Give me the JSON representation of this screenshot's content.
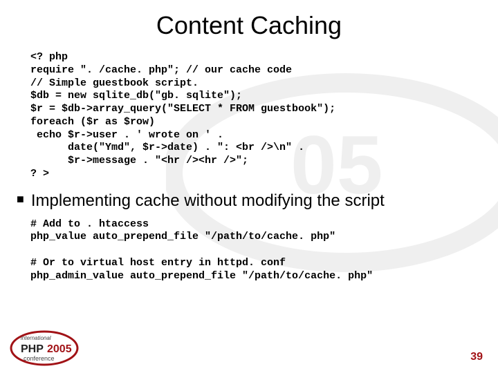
{
  "title": "Content Caching",
  "code_block_1": "<? php\nrequire \". /cache. php\"; // our cache code\n// Simple guestbook script.\n$db = new sqlite_db(\"gb. sqlite\");\n$r = $db->array_query(\"SELECT * FROM guestbook\");\nforeach ($r as $row)\n echo $r->user . ' wrote on ' .\n      date(\"Ymd\", $r->date) . \": <br />\\n\" .\n      $r->message . \"<hr /><hr />\";\n? >",
  "bullet_text": "Implementing cache without modifying the script",
  "code_block_2": "# Add to . htaccess\nphp_value auto_prepend_file \"/path/to/cache. php\"\n\n# Or to virtual host entry in httpd. conf\nphp_admin_value auto_prepend_file \"/path/to/cache. php\"",
  "page_number": "39",
  "logo": {
    "line1": "international",
    "line2": "PHP",
    "line3": "2005",
    "line4": "conference"
  }
}
